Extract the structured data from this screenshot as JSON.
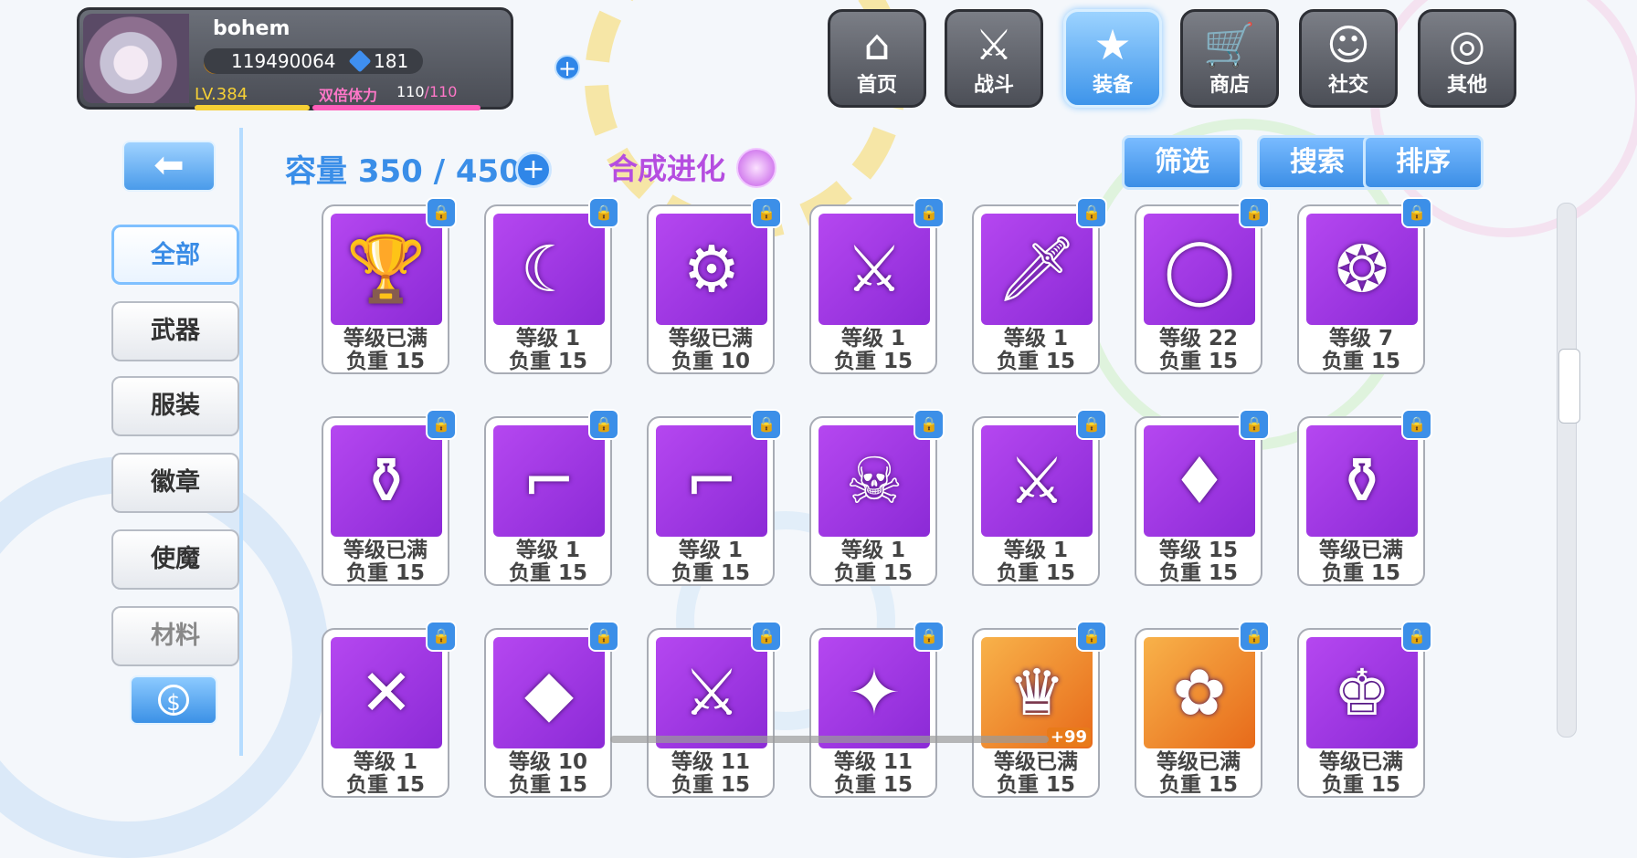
{
  "player": {
    "name": "bohem",
    "gold": "119490064",
    "gems": "181",
    "level": "LV.384",
    "level_progress": 0.7,
    "stamina_label": "双倍体力",
    "stamina_current": "110",
    "stamina_max": "/110",
    "stamina_fill": 1.0
  },
  "nav": [
    {
      "label": "首页",
      "icon": "house-icon"
    },
    {
      "label": "战斗",
      "icon": "swords-icon"
    },
    {
      "label": "装备",
      "icon": "star-gun-icon",
      "active": true
    },
    {
      "label": "商店",
      "icon": "cart-icon"
    },
    {
      "label": "社交",
      "icon": "ghost-icon"
    },
    {
      "label": "其他",
      "icon": "settings-icon"
    }
  ],
  "sidebar": {
    "back_icon": "back-arrow-icon",
    "items": [
      {
        "label": "全部",
        "active": true
      },
      {
        "label": "武器"
      },
      {
        "label": "服装"
      },
      {
        "label": "徽章"
      },
      {
        "label": "使魔"
      },
      {
        "label": "材料"
      }
    ],
    "currency_icon": "dollar-icon"
  },
  "toolbar": {
    "capacity": "容量 350 / 450",
    "synth": "合成进化",
    "filter": "筛选",
    "search": "搜索",
    "sort": "排序"
  },
  "items": [
    {
      "level": "等级已满",
      "weight": "负重 15",
      "icon": "chalice-icon"
    },
    {
      "level": "等级 1",
      "weight": "负重 15",
      "icon": "scythe-icon"
    },
    {
      "level": "等级已满",
      "weight": "负重 10",
      "icon": "turret-icon"
    },
    {
      "level": "等级 1",
      "weight": "负重 15",
      "icon": "bone-sword-icon"
    },
    {
      "level": "等级 1",
      "weight": "负重 15",
      "icon": "blade-icon"
    },
    {
      "level": "等级 22",
      "weight": "负重 15",
      "icon": "ring-icon"
    },
    {
      "level": "等级 7",
      "weight": "负重 15",
      "icon": "orb-pendant-icon"
    },
    {
      "level": "等级已满",
      "weight": "负重 15",
      "icon": "perfume-icon"
    },
    {
      "level": "等级 1",
      "weight": "负重 15",
      "icon": "pistol-icon"
    },
    {
      "level": "等级 1",
      "weight": "负重 15",
      "icon": "revolver-icon"
    },
    {
      "level": "等级 1",
      "weight": "负重 15",
      "icon": "skull-bottle-icon"
    },
    {
      "level": "等级 1",
      "weight": "负重 15",
      "icon": "rifle-icon"
    },
    {
      "level": "等级 15",
      "weight": "负重 15",
      "icon": "crest-icon"
    },
    {
      "level": "等级已满",
      "weight": "负重 15",
      "icon": "lantern-icon"
    },
    {
      "level": "等级 1",
      "weight": "负重 15",
      "icon": "crossbow-icon"
    },
    {
      "level": "等级 10",
      "weight": "负重 15",
      "icon": "crystal-icon"
    },
    {
      "level": "等级 11",
      "weight": "负重 15",
      "icon": "spear-icon"
    },
    {
      "level": "等级 11",
      "weight": "负重 15",
      "icon": "cannon-icon"
    },
    {
      "level": "等级已满",
      "weight": "负重 15",
      "icon": "dress-icon",
      "badge": "+99",
      "orange": true
    },
    {
      "level": "等级已满",
      "weight": "负重 15",
      "icon": "flower-dress-icon",
      "orange": true
    },
    {
      "level": "等级已满",
      "weight": "负重 15",
      "icon": "costume-icon"
    }
  ]
}
